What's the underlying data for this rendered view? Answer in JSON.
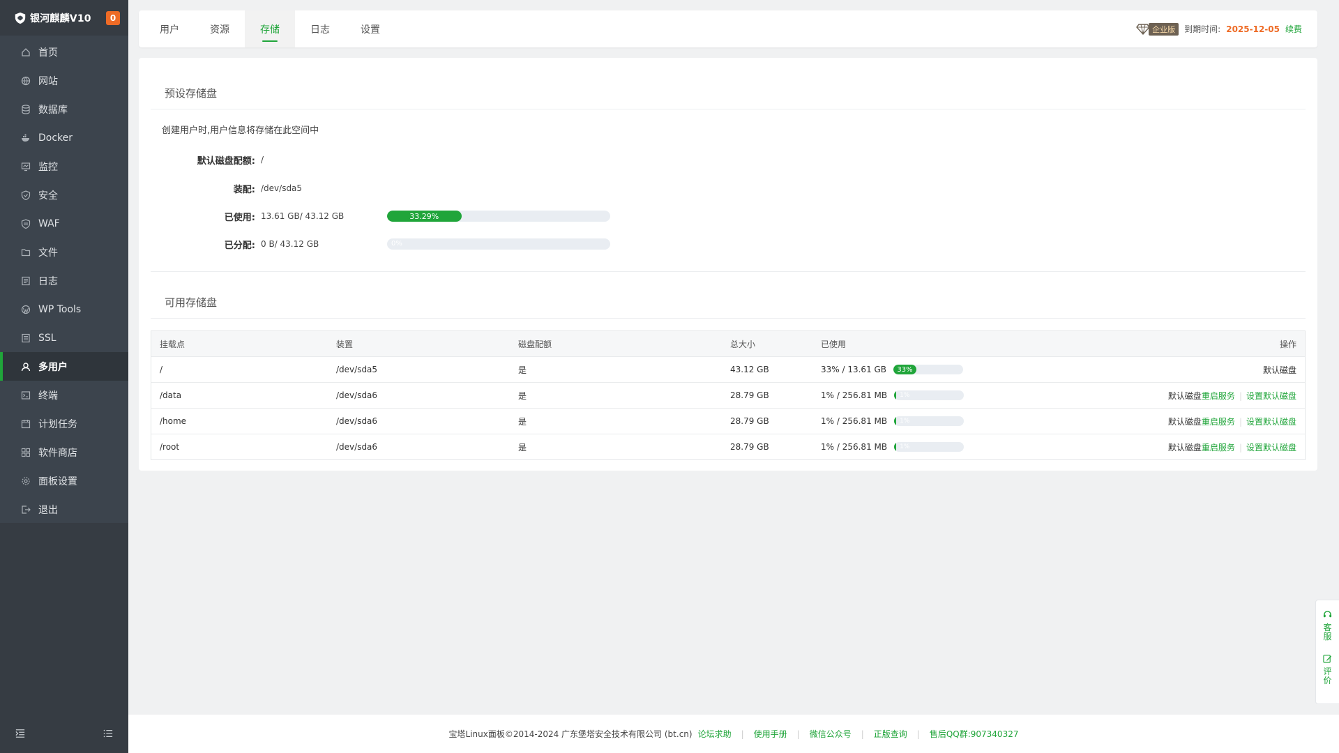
{
  "app": {
    "brand": "银河麒麟V10",
    "notification_count": "0"
  },
  "sidebar": {
    "items": [
      {
        "label": "首页",
        "icon": "home-icon"
      },
      {
        "label": "网站",
        "icon": "globe-icon"
      },
      {
        "label": "数据库",
        "icon": "database-icon"
      },
      {
        "label": "Docker",
        "icon": "docker-icon"
      },
      {
        "label": "监控",
        "icon": "monitor-icon"
      },
      {
        "label": "安全",
        "icon": "shield-icon"
      },
      {
        "label": "WAF",
        "icon": "waf-shield-icon"
      },
      {
        "label": "文件",
        "icon": "folder-icon"
      },
      {
        "label": "日志",
        "icon": "log-icon"
      },
      {
        "label": "WP Tools",
        "icon": "wordpress-icon"
      },
      {
        "label": "SSL",
        "icon": "ssl-icon"
      },
      {
        "label": "多用户",
        "icon": "users-icon"
      },
      {
        "label": "终端",
        "icon": "terminal-icon"
      },
      {
        "label": "计划任务",
        "icon": "calendar-icon"
      },
      {
        "label": "软件商店",
        "icon": "apps-icon"
      },
      {
        "label": "面板设置",
        "icon": "gear-icon"
      },
      {
        "label": "退出",
        "icon": "logout-icon"
      }
    ],
    "active_index": 11
  },
  "tabs": [
    "用户",
    "资源",
    "存储",
    "日志",
    "设置"
  ],
  "active_tab": 2,
  "header": {
    "edition": "企业版",
    "expire_label": "到期时间:",
    "expire_date": "2025-12-05",
    "renew": "续费"
  },
  "preset": {
    "title": "预设存储盘",
    "description": "创建用户时,用户信息将存储在此空间中",
    "fields": {
      "quota_label": "默认磁盘配额:",
      "quota_value": "/",
      "mount_label": "装配:",
      "mount_value": "/dev/sda5",
      "used_label": "已使用:",
      "used_value": "13.61 GB/ 43.12 GB",
      "used_percent": 33.29,
      "used_percent_text": "33.29%",
      "alloc_label": "已分配:",
      "alloc_value": "0 B/ 43.12 GB",
      "alloc_percent": 0,
      "alloc_percent_text": "0%"
    }
  },
  "available": {
    "title": "可用存储盘",
    "columns": [
      "挂载点",
      "装置",
      "磁盘配额",
      "总大小",
      "已使用",
      "操作"
    ],
    "rows": [
      {
        "mount": "/",
        "device": "/dev/sda5",
        "quota": "是",
        "total": "43.12 GB",
        "used": "33% / 13.61 GB",
        "percent": 33,
        "percent_text": "33%",
        "default_text": "默认磁盘",
        "restart": "",
        "set_default": ""
      },
      {
        "mount": "/data",
        "device": "/dev/sda6",
        "quota": "是",
        "total": "28.79 GB",
        "used": "1% / 256.81 MB",
        "percent": 1,
        "percent_text": "1%",
        "default_text": "默认磁盘",
        "restart": "重启服务",
        "set_default": "设置默认磁盘"
      },
      {
        "mount": "/home",
        "device": "/dev/sda6",
        "quota": "是",
        "total": "28.79 GB",
        "used": "1% / 256.81 MB",
        "percent": 1,
        "percent_text": "1%",
        "default_text": "默认磁盘",
        "restart": "重启服务",
        "set_default": "设置默认磁盘"
      },
      {
        "mount": "/root",
        "device": "/dev/sda6",
        "quota": "是",
        "total": "28.79 GB",
        "used": "1% / 256.81 MB",
        "percent": 1,
        "percent_text": "1%",
        "default_text": "默认磁盘",
        "restart": "重启服务",
        "set_default": "设置默认磁盘"
      }
    ]
  },
  "footer": {
    "copyright": "宝塔Linux面板©2014-2024 广东堡塔安全技术有限公司 (bt.cn)",
    "links": [
      "论坛求助",
      "使用手册",
      "微信公众号",
      "正版查询",
      "售后QQ群:907340327"
    ]
  },
  "float": {
    "service": "客服",
    "review": "评价"
  },
  "colors": {
    "accent": "#20a53a",
    "sidebar": "#3c444d",
    "orange": "#ee6b26"
  }
}
